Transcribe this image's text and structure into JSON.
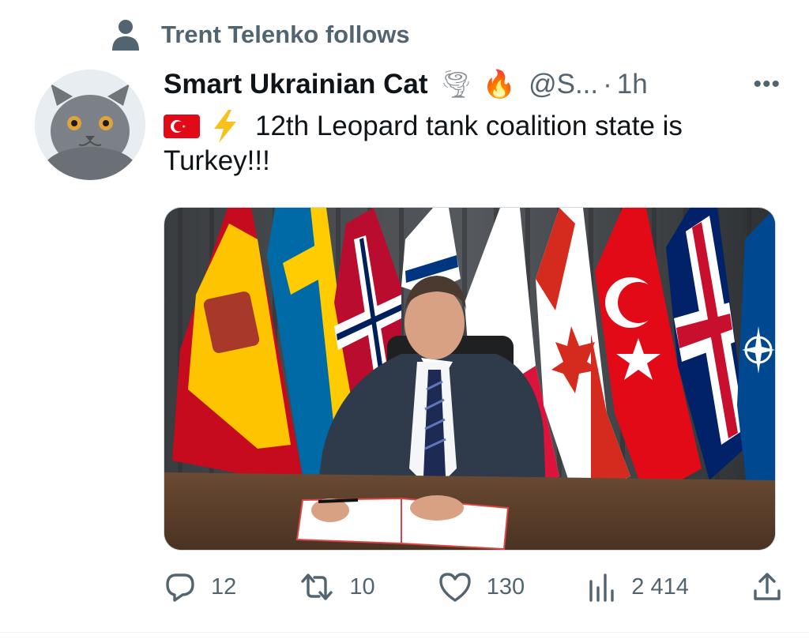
{
  "social_context": {
    "icon": "person-icon",
    "text": "Trent Telenko follows"
  },
  "tweet": {
    "author": {
      "display_name": "Smart Ukrainian Cat",
      "name_emojis": [
        "🌪",
        "🔥"
      ],
      "handle": "@S...",
      "separator": "·",
      "time": "1h",
      "avatar": "cat-avatar"
    },
    "more_label": "•••",
    "text": "12th Leopard tank coalition state is Turkey!!!",
    "text_prefix_icons": [
      "turkey-flag-icon",
      "lightning-icon"
    ],
    "image_alt": "Official signing at a desk in front of national flags"
  },
  "actions": {
    "reply_count": "12",
    "retweet_count": "10",
    "like_count": "130",
    "views_count": "2 414"
  },
  "colors": {
    "text_primary": "#0f1419",
    "text_secondary": "#536471",
    "divider": "#eff3f4"
  }
}
